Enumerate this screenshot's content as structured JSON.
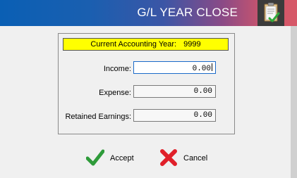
{
  "header": {
    "title": "G/L YEAR CLOSE",
    "icon": "clipboard-check-icon"
  },
  "year": {
    "label": "Current Accounting Year:",
    "value": "9999"
  },
  "fields": {
    "income": {
      "label": "Income:",
      "value": "0.00"
    },
    "expense": {
      "label": "Expense:",
      "value": "0.00"
    },
    "retained": {
      "label": "Retained Earnings:",
      "value": "0.00"
    }
  },
  "buttons": {
    "accept": {
      "label": "Accept",
      "icon": "checkmark-icon"
    },
    "cancel": {
      "label": "Cancel",
      "icon": "x-cross-icon"
    }
  },
  "colors": {
    "title_gradient_start": "#0a5fb4",
    "title_gradient_end": "#d65868",
    "highlight": "#ffff00",
    "accept_green": "#2e9b3a",
    "cancel_red": "#e0202a"
  }
}
